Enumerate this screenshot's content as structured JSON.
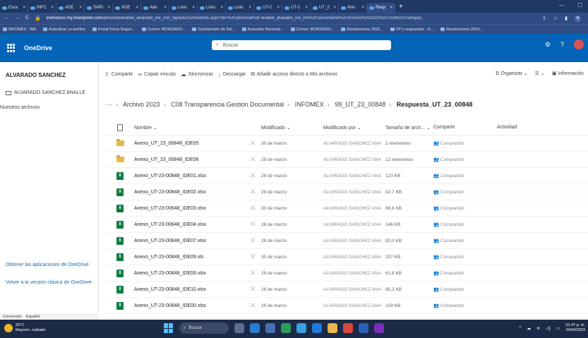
{
  "browser": {
    "tabs": [
      {
        "label": "Esca",
        "active": false
      },
      {
        "label": "INFC",
        "active": false
      },
      {
        "label": "ADE",
        "active": false
      },
      {
        "label": "SARI",
        "active": false
      },
      {
        "label": "ADE",
        "active": false
      },
      {
        "label": "Ade",
        "active": false
      },
      {
        "label": "Listo",
        "active": false
      },
      {
        "label": "Listo",
        "active": false
      },
      {
        "label": "Listo",
        "active": false
      },
      {
        "label": "UT-2",
        "active": false
      },
      {
        "label": "UT-2",
        "active": false
      },
      {
        "label": "UT_2",
        "active": false
      },
      {
        "label": "Ane:",
        "active": false
      },
      {
        "label": "Resp",
        "active": true
      }
    ],
    "url_domain": "inemexico-my.sharepoint.com",
    "url_rest": "/personal/analleli_alvarado_ine_mx/_layouts/15/onedrive.aspx?id=%2Fpersonal%2Fanalleli_alvarado_ine_mx%2FDocuments%2FArchivo%202023%2FC08%20Transpar...",
    "bookmarks": [
      "INFOMEX - INE",
      "Autenticar | e-archivo",
      "Portal Firma Seguri...",
      "Correo: MORGADO...",
      "Cuestionario de Sal...",
      "Buscador Nacional...",
      "Correo: MORGADO...",
      "Resoluciones 2022...",
      "VP y respuestas - O...",
      "Resoluciones 2019..."
    ],
    "profile_initial": "N"
  },
  "app": {
    "title": "OneDrive",
    "search_placeholder": "Buscar"
  },
  "leftnav": {
    "user": "ALVARADO SANCHEZ",
    "folder": "ALVARADO SANCHEZ ANALLE",
    "shared": "Nuestros archivos",
    "get_apps": "Obtener las aplicaciones de OneDrive",
    "classic": "Volver a la versión clásica de OneDrive",
    "status_left": "Corrección",
    "status_lang": "Español"
  },
  "commands": {
    "share": "Compartir",
    "copy_link": "Copiar vínculo",
    "sync": "Sincronizar",
    "download": "Descargar",
    "add_shortcut": "Añadir acceso directo a Mis archivos",
    "organize": "Organizar",
    "info": "Información"
  },
  "breadcrumb": [
    "Archivo 2023",
    "C08 Transparencia Gestión Documental",
    "INFOMEX",
    "99_UT_23_00848",
    "Respuesta_UT_23_00848"
  ],
  "list": {
    "headers": {
      "name": "Nombre",
      "modified": "Modificado",
      "modified_by": "Modificado por",
      "size": "Tamaño de arch...",
      "sharing": "Compartir",
      "activity": "Actividad"
    },
    "rows": [
      {
        "type": "folder",
        "name": "Anexo_UT_23_00848_IDE05",
        "modified": "30 de marzo",
        "by": "ALVARADO SANCHEZ ANA",
        "size": "2 elementos",
        "sharing": "Compartido"
      },
      {
        "type": "folder",
        "name": "Anexo_UT_23_00848_IDE06",
        "modified": "29 de marzo",
        "by": "ALVARADO SANCHEZ ANA",
        "size": "12 elementos",
        "sharing": "Compartido"
      },
      {
        "type": "xlsx",
        "name": "Anexo_UT-23-00848_IDE01.xlsx",
        "modified": "29 de marzo",
        "by": "ALVARADO SANCHEZ ANA",
        "size": "123 KB",
        "sharing": "Compartido"
      },
      {
        "type": "xlsx",
        "name": "Anexo_UT-23-00848_IDE02.xlsx",
        "modified": "29 de marzo",
        "by": "ALVARADO SANCHEZ ANA",
        "size": "82,7 KB",
        "sharing": "Compartido"
      },
      {
        "type": "xlsx",
        "name": "Anexo_UT-23-00848_IDE03.xlsx",
        "modified": "30 de marzo",
        "by": "ALVARADO SANCHEZ ANA",
        "size": "66,6 KB",
        "sharing": "Compartido"
      },
      {
        "type": "xlsx",
        "name": "Anexo_UT-23-00848_IDE04.xlsx",
        "modified": "28 de marzo",
        "by": "ALVARADO SANCHEZ ANA",
        "size": "146 KB",
        "sharing": "Compartido"
      },
      {
        "type": "xlsx",
        "name": "Anexo_UT-23-00848_IDE07.xlsx",
        "modified": "28 de marzo",
        "by": "ALVARADO SANCHEZ ANA",
        "size": "82,0 KB",
        "sharing": "Compartido"
      },
      {
        "type": "xlsx",
        "name": "Anexo_UT-23-00848_IDE09.xls",
        "modified": "30 de marzo",
        "by": "ALVARADO SANCHEZ ANA",
        "size": "207 KB",
        "sharing": "Compartido"
      },
      {
        "type": "xlsx",
        "name": "Anexo_UT-23-00848_IDE09.xlsx",
        "modified": "29 de marzo",
        "by": "ALVARADO SANCHEZ ANA",
        "size": "61,8 KB",
        "sharing": "Compartido"
      },
      {
        "type": "xlsx",
        "name": "Anexo_UT-23-00848_IDE10.xlsx",
        "modified": "29 de marzo",
        "by": "ALVARADO SANCHEZ ANA",
        "size": "95,3 KB",
        "sharing": "Compartido"
      },
      {
        "type": "xlsx",
        "name": "Anexo_UT-23-00848_IDE00.xlsx",
        "modified": "29 de marzo",
        "by": "ALVARADO SANCHEZ ANA",
        "size": "159 KB",
        "sharing": "Compartido"
      }
    ]
  },
  "taskbar": {
    "temp": "26°C",
    "weather": "Mayorm. nublado",
    "search": "Buscar",
    "time": "01:47 p. m.",
    "date": "24/04/2023"
  },
  "colors": {
    "appbar": "#0364b8",
    "tabbar": "#1f3864",
    "taskbar": "#1b2a47",
    "excel": "#107c41",
    "folder": "#e8b94a"
  }
}
